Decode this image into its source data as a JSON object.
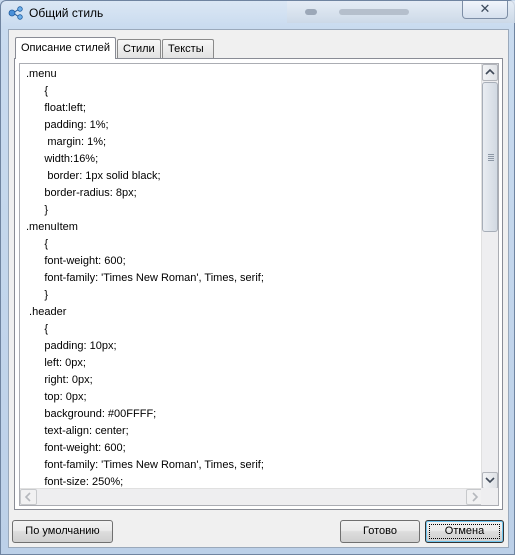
{
  "window": {
    "title": "Общий стиль"
  },
  "tabs": [
    {
      "label": "Описание стилей",
      "active": true
    },
    {
      "label": "Стили",
      "active": false
    },
    {
      "label": "Тексты",
      "active": false
    }
  ],
  "editor": {
    "lines": [
      ".menu",
      "      {",
      "      float:left;",
      "      padding: 1%;",
      "       margin: 1%;",
      "      width:16%;",
      "       border: 1px solid black;",
      "      border-radius: 8px;",
      "      }",
      ".menuItem",
      "      {",
      "      font-weight: 600;",
      "      font-family: 'Times New Roman', Times, serif;",
      "      }",
      " .header",
      "      {",
      "      padding: 10px;",
      "      left: 0px;",
      "      right: 0px;",
      "      top: 0px;",
      "      background: #00FFFF;",
      "      text-align: center;",
      "      font-weight: 600;",
      "      font-family: 'Times New Roman', Times, serif;",
      "      font-size: 250%;",
      "      }"
    ]
  },
  "buttons": {
    "default": "По умолчанию",
    "ok": "Готово",
    "cancel": "Отмена"
  },
  "icons": {
    "window_icon": "style-sharing-icon",
    "close": "close-icon",
    "scroll_up": "chevron-up-icon",
    "scroll_down": "chevron-down-icon",
    "scroll_left": "chevron-left-icon",
    "scroll_right": "chevron-right-icon"
  },
  "colors": {
    "accent": "#3c7fb1",
    "frame": "#c9dbef"
  }
}
